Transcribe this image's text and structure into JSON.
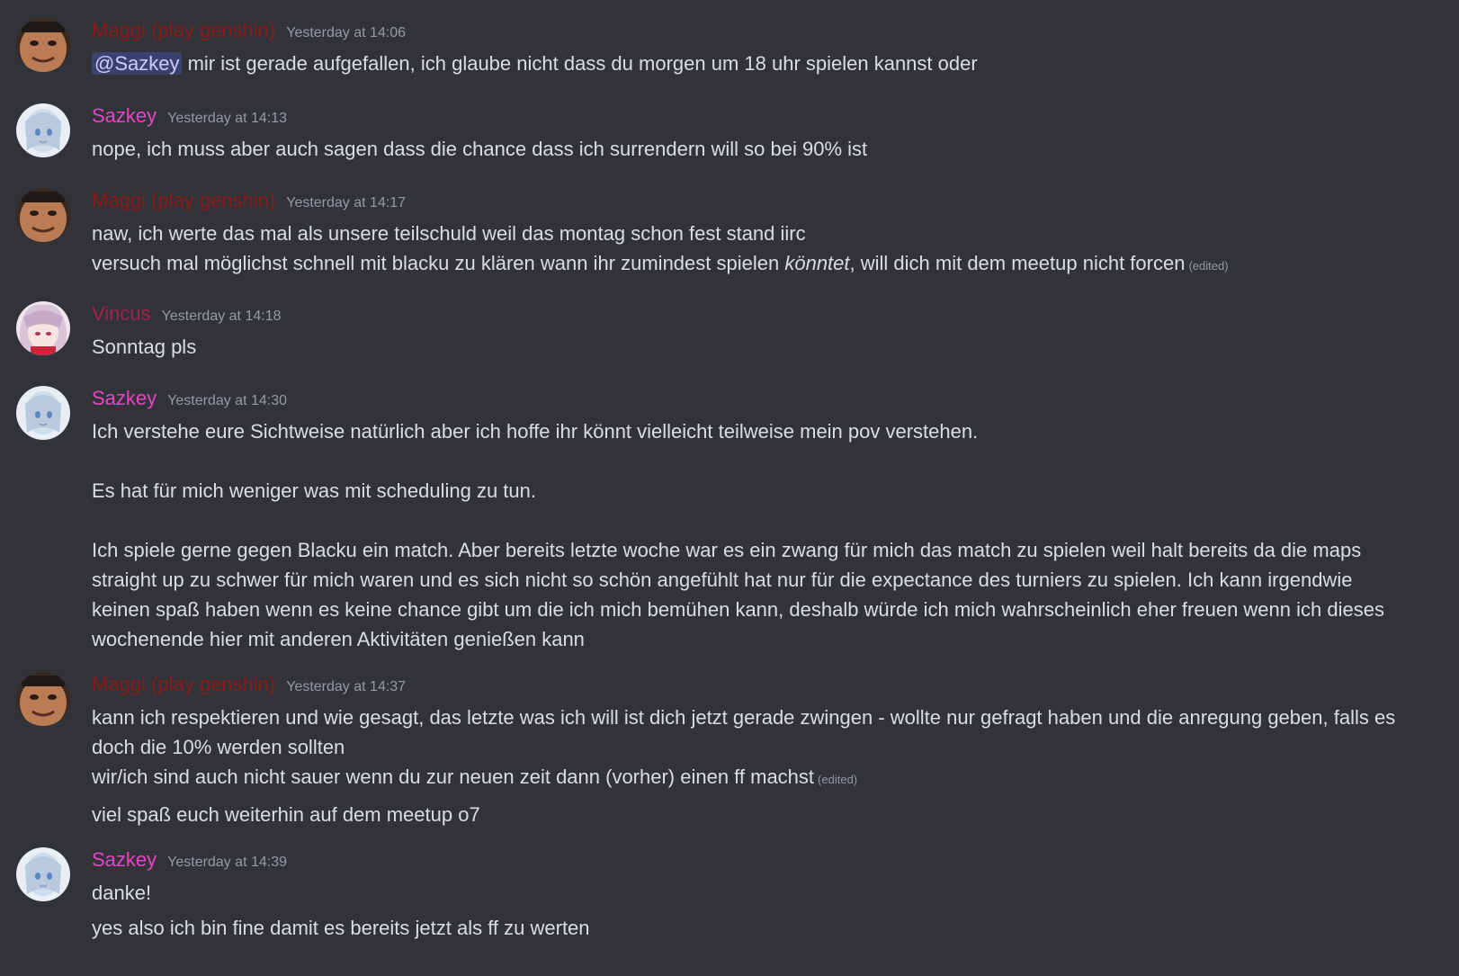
{
  "colors": {
    "background": "#313338",
    "text": "#dbdee1",
    "muted": "#949ba4",
    "maggi": "#8b1a1a",
    "sazkey": "#e844c6",
    "vincus": "#a3234a",
    "mention_bg": "#3c4270"
  },
  "messages": [
    {
      "author": "Maggi (play genshin)",
      "avatar_icon": "user-avatar-maggi-icon",
      "time": "Yesterday at 14:06",
      "lines": [
        {
          "mention": "@Sazkey",
          "text": " mir ist gerade aufgefallen, ich glaube nicht dass du morgen um 18 uhr spielen kannst oder"
        }
      ]
    },
    {
      "author": "Sazkey",
      "avatar_icon": "user-avatar-sazkey-icon",
      "time": "Yesterday at 14:13",
      "lines": [
        {
          "text": "nope, ich muss aber auch sagen dass die chance dass ich surrendern will so bei 90% ist"
        }
      ]
    },
    {
      "author": "Maggi (play genshin)",
      "avatar_icon": "user-avatar-maggi-icon",
      "time": "Yesterday at 14:17",
      "lines": [
        {
          "text": "naw, ich werte das mal als unsere teilschuld weil das montag schon fest stand iirc"
        },
        {
          "text_before": "versuch mal möglichst schnell mit blacku zu klären wann ihr zumindest spielen ",
          "italic": "könntet",
          "text_after": ", will dich mit dem meetup nicht forcen",
          "edited": "(edited)"
        }
      ]
    },
    {
      "author": "Vincus",
      "avatar_icon": "user-avatar-vincus-icon",
      "time": "Yesterday at 14:18",
      "lines": [
        {
          "text": "Sonntag pls"
        }
      ]
    },
    {
      "author": "Sazkey",
      "avatar_icon": "user-avatar-sazkey-icon",
      "time": "Yesterday at 14:30",
      "lines": [
        {
          "text": "Ich verstehe eure Sichtweise natürlich aber ich hoffe ihr könnt vielleicht teilweise mein pov verstehen."
        },
        {
          "text": "Es hat für mich weniger was mit scheduling zu tun."
        },
        {
          "text": "Ich spiele gerne gegen Blacku ein match. Aber bereits letzte woche war es ein zwang für mich das match zu spielen weil halt bereits da die maps"
        },
        {
          "text": "straight up zu schwer für mich waren und es sich nicht so schön angefühlt hat nur für die expectance des turniers zu spielen. Ich kann irgendwie"
        },
        {
          "text": "keinen spaß haben wenn es keine chance gibt um die ich mich bemühen kann, deshalb würde ich mich wahrscheinlich eher freuen wenn ich dieses"
        },
        {
          "text": "wochenende hier mit anderen Aktivitäten genießen kann"
        }
      ]
    },
    {
      "author": "Maggi (play genshin)",
      "avatar_icon": "user-avatar-maggi-icon",
      "time": "Yesterday at 14:37",
      "lines": [
        {
          "text": "kann ich respektieren und wie gesagt, das letzte was ich will ist dich jetzt gerade zwingen - wollte nur gefragt haben und die anregung geben, falls es"
        },
        {
          "text": "doch die 10% werden sollten"
        },
        {
          "text": "wir/ich sind auch nicht sauer wenn du zur neuen zeit dann (vorher) einen ff machst",
          "edited": "(edited)"
        },
        {
          "text": "viel spaß euch weiterhin auf dem meetup o7"
        }
      ]
    },
    {
      "author": "Sazkey",
      "avatar_icon": "user-avatar-sazkey-icon",
      "time": "Yesterday at 14:39",
      "lines": [
        {
          "text": "danke!"
        },
        {
          "text": "yes also ich bin fine damit es bereits jetzt als ff zu werten"
        }
      ]
    }
  ]
}
